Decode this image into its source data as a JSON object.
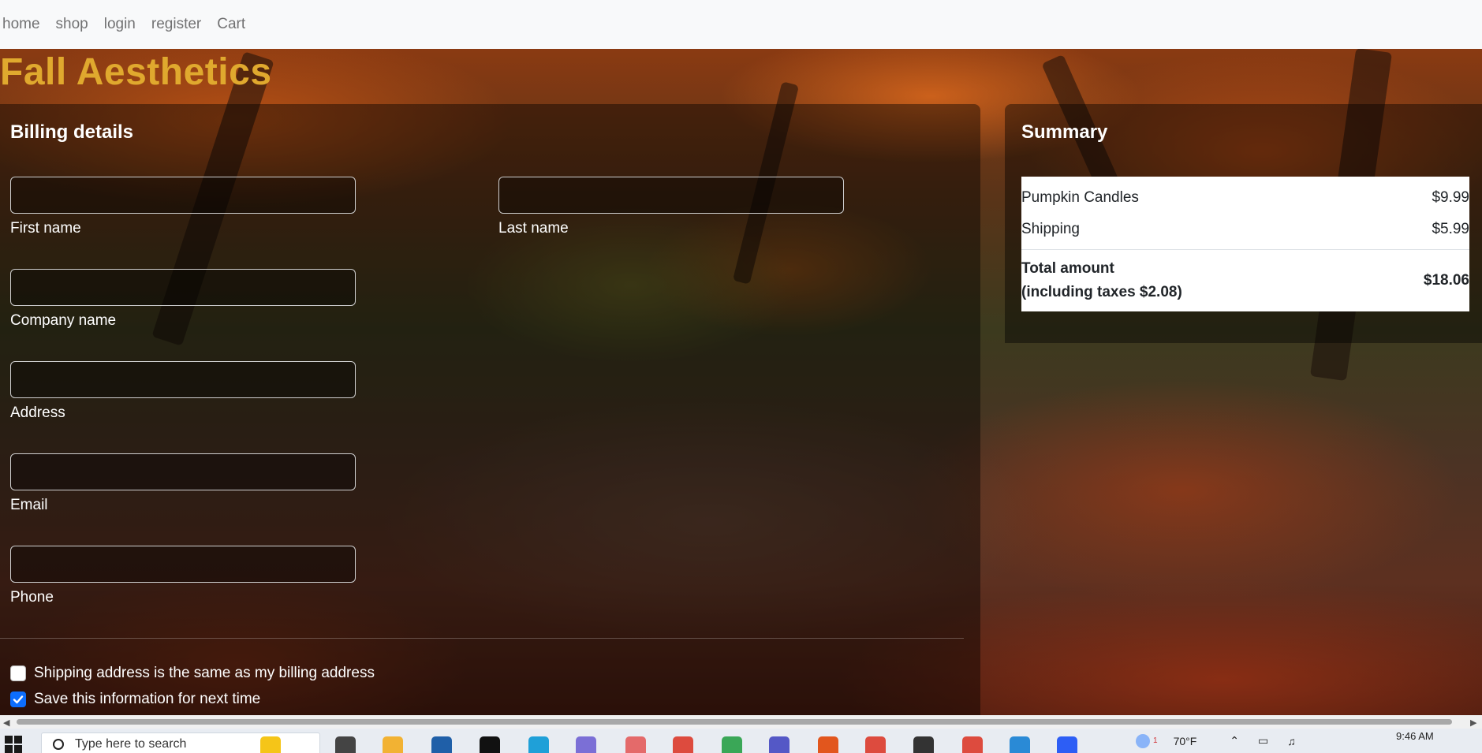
{
  "nav": {
    "items": [
      "home",
      "shop",
      "login",
      "register",
      "Cart"
    ]
  },
  "brand": {
    "title": "Fall Aesthetics"
  },
  "billing": {
    "heading": "Billing details",
    "fields": {
      "first_name": {
        "label": "First name",
        "value": ""
      },
      "last_name": {
        "label": "Last name",
        "value": ""
      },
      "company": {
        "label": "Company name",
        "value": ""
      },
      "address": {
        "label": "Address",
        "value": ""
      },
      "email": {
        "label": "Email",
        "value": ""
      },
      "phone": {
        "label": "Phone",
        "value": ""
      }
    },
    "checkboxes": {
      "same_address": {
        "label": "Shipping address is the same as my billing address",
        "checked": false
      },
      "save_info": {
        "label": "Save this information for next time",
        "checked": true
      }
    }
  },
  "summary": {
    "heading": "Summary",
    "items": [
      {
        "name": "Pumpkin Candles",
        "price": "$9.99"
      },
      {
        "name": "Shipping",
        "price": "$5.99"
      }
    ],
    "total": {
      "label_line1": "Total amount",
      "label_line2": "(including taxes $2.08)",
      "value": "$18.06"
    }
  },
  "taskbar": {
    "search_placeholder": "Type here to search",
    "weather": "70°F",
    "time": "9:46 AM",
    "notification_count": "1"
  },
  "colors": {
    "brand": "#e0a92e",
    "checkbox_checked": "#0d6efd",
    "navbar_bg": "#f8f9fa"
  }
}
